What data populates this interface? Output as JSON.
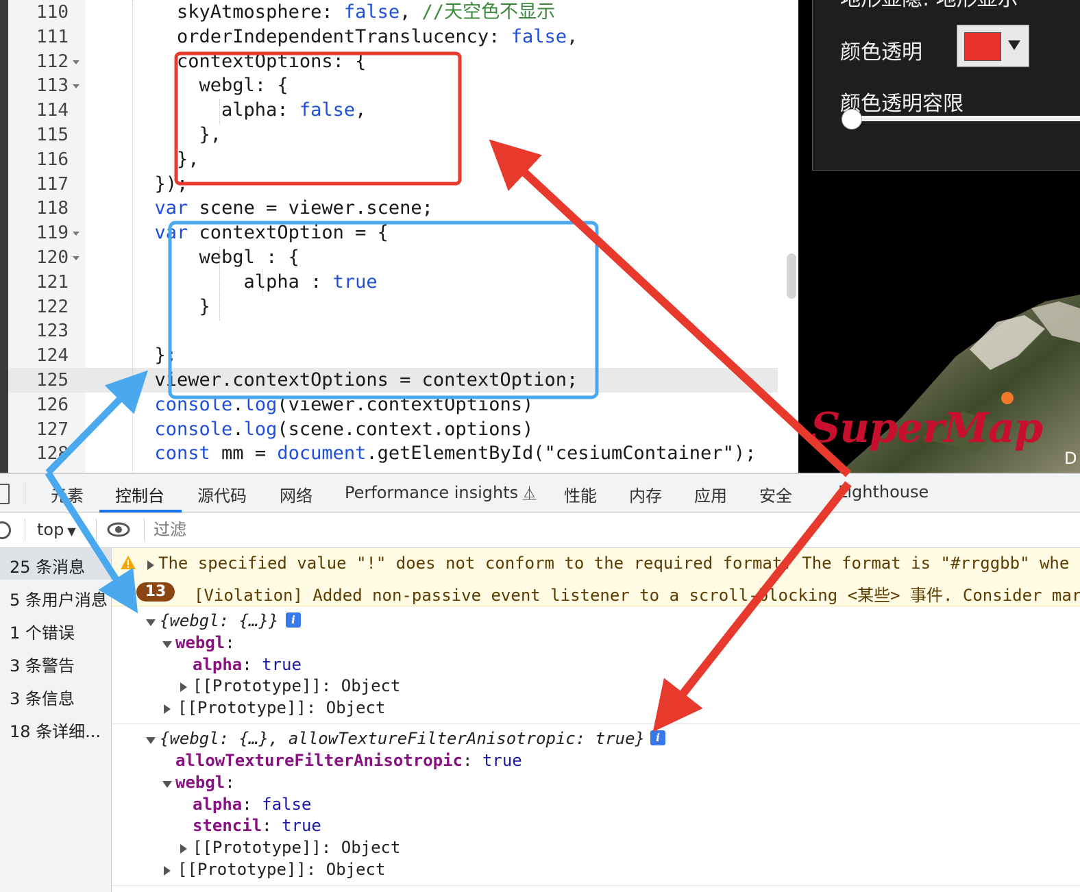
{
  "editor": {
    "lines": [
      {
        "n": "110",
        "parts": [
          {
            "t": "    skyAtmosphere: "
          },
          {
            "t": "false",
            "c": "kw"
          },
          {
            "t": ", "
          },
          {
            "t": "//天空色不显示",
            "c": "cm"
          }
        ]
      },
      {
        "n": "111",
        "parts": [
          {
            "t": "    orderIndependentTranslucency: "
          },
          {
            "t": "false",
            "c": "kw"
          },
          {
            "t": ","
          }
        ]
      },
      {
        "n": "112",
        "fold": true,
        "parts": [
          {
            "t": "    contextOptions: {"
          }
        ]
      },
      {
        "n": "113",
        "fold": true,
        "parts": [
          {
            "t": "      webgl: {"
          }
        ]
      },
      {
        "n": "114",
        "parts": [
          {
            "t": "        alpha: "
          },
          {
            "t": "false",
            "c": "kw"
          },
          {
            "t": ","
          }
        ]
      },
      {
        "n": "115",
        "parts": [
          {
            "t": "      },"
          }
        ]
      },
      {
        "n": "116",
        "parts": [
          {
            "t": "    },"
          }
        ]
      },
      {
        "n": "117",
        "parts": [
          {
            "t": "  });"
          }
        ]
      },
      {
        "n": "118",
        "parts": [
          {
            "t": "  "
          },
          {
            "t": "var",
            "c": "kw"
          },
          {
            "t": " scene = viewer.scene;"
          }
        ]
      },
      {
        "n": "119",
        "fold": true,
        "parts": [
          {
            "t": "  "
          },
          {
            "t": "var",
            "c": "kw"
          },
          {
            "t": " contextOption = {"
          }
        ]
      },
      {
        "n": "120",
        "fold": true,
        "parts": [
          {
            "t": "      webgl : {"
          }
        ]
      },
      {
        "n": "121",
        "parts": [
          {
            "t": "          alpha : "
          },
          {
            "t": "true",
            "c": "kw"
          }
        ]
      },
      {
        "n": "122",
        "parts": [
          {
            "t": "      }"
          }
        ]
      },
      {
        "n": "123",
        "parts": [
          {
            "t": ""
          }
        ]
      },
      {
        "n": "124",
        "parts": [
          {
            "t": "  };"
          }
        ]
      },
      {
        "n": "125",
        "active": true,
        "parts": [
          {
            "t": "  viewer.contextOptions = contextOption;"
          }
        ]
      },
      {
        "n": "126",
        "parts": [
          {
            "t": "  "
          },
          {
            "t": "console",
            "c": "kw"
          },
          {
            "t": "."
          },
          {
            "t": "log",
            "c": "kw"
          },
          {
            "t": "(viewer.contextOptions)"
          }
        ]
      },
      {
        "n": "127",
        "parts": [
          {
            "t": "  "
          },
          {
            "t": "console",
            "c": "kw"
          },
          {
            "t": "."
          },
          {
            "t": "log",
            "c": "kw"
          },
          {
            "t": "(scene.context.options)"
          }
        ]
      },
      {
        "n": "128",
        "parts": [
          {
            "t": "  "
          },
          {
            "t": "const",
            "c": "kw"
          },
          {
            "t": " mm = "
          },
          {
            "t": "document",
            "c": "kw"
          },
          {
            "t": ".getElementById(\"cesiumContainer\");"
          }
        ]
      }
    ]
  },
  "viewer": {
    "top_partial_label": "地形显隐: 地形显示",
    "color_alpha_label": "颜色透明",
    "color_tolerance_label": "颜色透明容限",
    "color_value": "#e8322a",
    "tolerance_level": 0,
    "logo_text": "SuperMap",
    "corner_text": "D"
  },
  "devtools": {
    "tabs": [
      "元素",
      "控制台",
      "源代码",
      "网络",
      "Performance insights",
      "性能",
      "内存",
      "应用",
      "安全",
      "Lighthouse"
    ],
    "selected_tab": "控制台",
    "context_select": "top",
    "filter_placeholder": "过滤",
    "sidebar": [
      "25 条消息",
      "5 条用户消息",
      "1 个错误",
      "3 条警告",
      "3 条信息",
      "18 条详细..."
    ],
    "console": {
      "warning_text": "The specified value \"!\" does not conform to the required format.  The format is \"#rrggbb\" whe",
      "violation_count": "13",
      "violation_text": "[Violation] Added non-passive event listener to a scroll-blocking <某些> 事件. Consider mar",
      "obj1_summary": "{webgl: {…}}",
      "obj2_summary": "{webgl: {…}, allowTextureFilterAnisotropic: true}",
      "k_webgl": "webgl",
      "k_alpha": "alpha",
      "k_stencil": "stencil",
      "k_anisotropic": "allowTextureFilterAnisotropic",
      "v_true": "true",
      "v_false": "false",
      "proto": "[[Prototype]]",
      "proto_val": "Object"
    }
  },
  "colors": {
    "red_annotation": "#e8392d",
    "blue_annotation": "#4aa8ef",
    "keyword": "#1f4fdc",
    "console_key": "#881280"
  }
}
